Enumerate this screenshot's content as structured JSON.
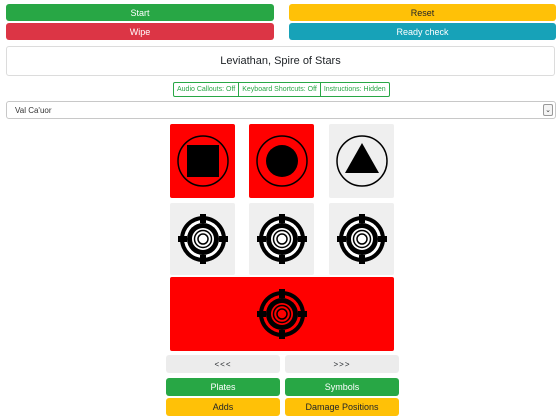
{
  "controls": {
    "start": "Start",
    "reset": "Reset",
    "wipe": "Wipe",
    "ready_check": "Ready check"
  },
  "raid_title": "Leviathan, Spire of Stars",
  "toggles": {
    "audio": "Audio Callouts: Off",
    "keyboard": "Keyboard Shortcuts: Off",
    "instructions": "Instructions: Hidden"
  },
  "encounter": {
    "selected": "Val Ca'uor",
    "arrow": "⌄"
  },
  "symbol_grid": [
    {
      "symbol": "square-in-circle-icon",
      "active": true
    },
    {
      "symbol": "circle-in-circle-icon",
      "active": true
    },
    {
      "symbol": "triangle-in-circle-icon",
      "active": false
    },
    {
      "symbol": "plate-target-icon",
      "active": false
    },
    {
      "symbol": "plate-target-icon",
      "active": false
    },
    {
      "symbol": "plate-target-icon",
      "active": false
    },
    {
      "symbol": "plate-target-icon",
      "active": true
    }
  ],
  "colors": {
    "active": "#ff0000",
    "inactive": "#efefef",
    "green": "#28a745",
    "yellow": "#ffc107",
    "red": "#dc3545",
    "teal": "#17a2b8"
  },
  "nav": {
    "prev": "<<<",
    "next": ">>>"
  },
  "modes": {
    "plates": "Plates",
    "symbols": "Symbols",
    "adds": "Adds",
    "damage_positions": "Damage Positions"
  }
}
